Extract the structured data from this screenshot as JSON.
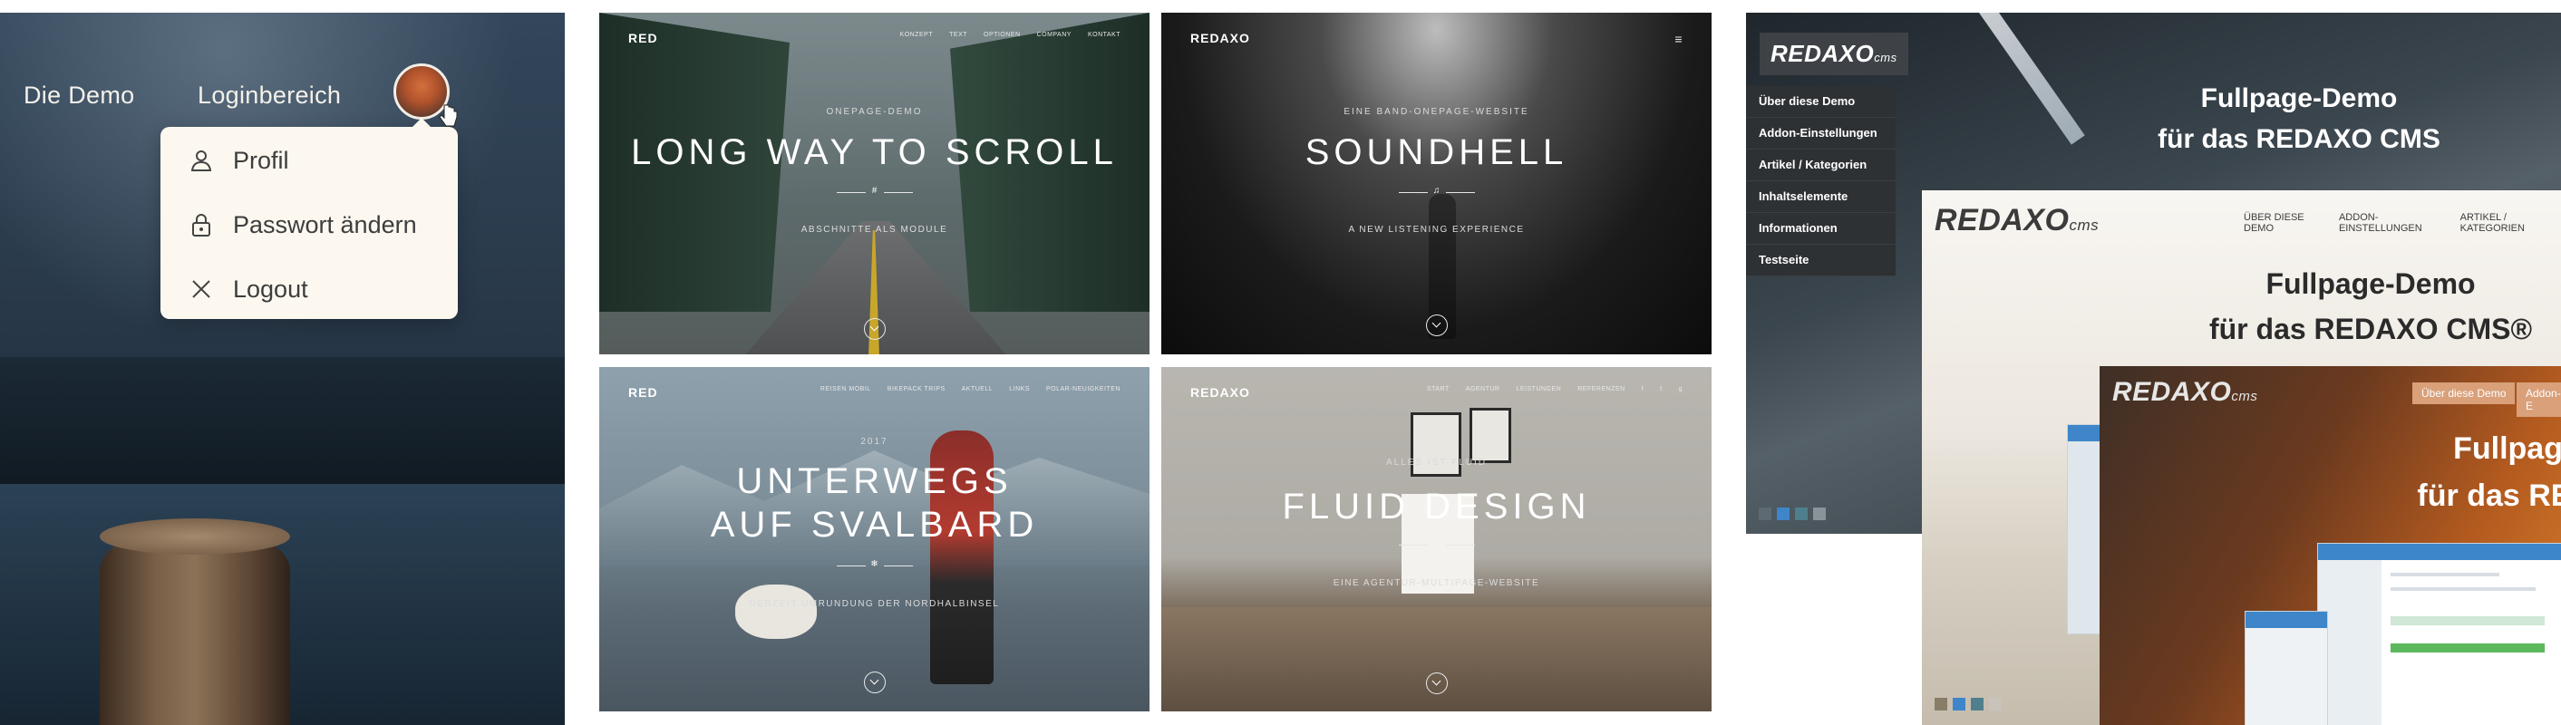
{
  "login_panel": {
    "nav": [
      "Die Demo",
      "Loginbereich"
    ],
    "menu": [
      {
        "label": "Profil",
        "icon": "user-icon"
      },
      {
        "label": "Passwort ändern",
        "icon": "lock-icon"
      },
      {
        "label": "Logout",
        "icon": "close-icon"
      }
    ]
  },
  "tiles": [
    {
      "logo": "RED",
      "menu": [
        "KONZEPT",
        "TEXT",
        "OPTIONEN",
        "COMPANY",
        "KONTAKT"
      ],
      "kicker": "ONEPAGE-DEMO",
      "title": "LONG WAY TO SCROLL",
      "divider_glyph": "#",
      "subtitle": "ABSCHNITTE ALS MODULE"
    },
    {
      "logo": "REDAXO",
      "menu": [
        "≡"
      ],
      "kicker": "EINE BAND-ONEPAGE-WEBSITE",
      "title": "SOUNDHELL",
      "divider_glyph": "♫",
      "subtitle": "A NEW LISTENING EXPERIENCE"
    },
    {
      "logo": "RED",
      "menu": [
        "REISEN MOBIL",
        "BIKEPACK TRIPS",
        "AKTUELL",
        "LINKS",
        "POLAR-NEUIGKEITEN"
      ],
      "kicker": "2017",
      "title": "UNTERWEGS AUF SVALBARD",
      "divider_glyph": "❄",
      "subtitle": "DERZEIT UMRUNDUNG DER NORDHALBINSEL"
    },
    {
      "logo": "REDAXO",
      "menu": [
        "START",
        "AGENTUR",
        "LEISTUNGEN",
        "REFERENZEN",
        "f",
        "t",
        "g"
      ],
      "kicker": "ALLES IST FLUID",
      "title": "FLUID DESIGN",
      "divider_glyph": "",
      "subtitle": "EINE AGENTUR-MULTIPAGE-WEBSITE"
    }
  ],
  "redaxo": {
    "logo": "REDAXO",
    "logo_suffix": "cms",
    "sidebar": [
      "Über diese Demo",
      "Addon-Einstellungen",
      "Artikel / Kategorien",
      "Inhaltselemente",
      "Informationen",
      "Testseite"
    ],
    "headline_1": "Fullpage-Demo",
    "headline_2": "für das REDAXO CMS",
    "card2_menu": [
      "ÜBER DIESE DEMO",
      "ADDON-EINSTELLUNGEN",
      "ARTIKEL / KATEGORIEN"
    ],
    "card2_headline_1": "Fullpage-Demo",
    "card2_headline_2": "für das REDAXO CMS®",
    "card3_buttons": [
      "Über diese Demo",
      "Addon-E"
    ],
    "card3_headline_1": "Fullpage",
    "card3_headline_2": "für das REDA",
    "swatch_colors": [
      "#5d6a73",
      "#3e86c9",
      "#4f7f8c",
      "#8a9399"
    ]
  }
}
